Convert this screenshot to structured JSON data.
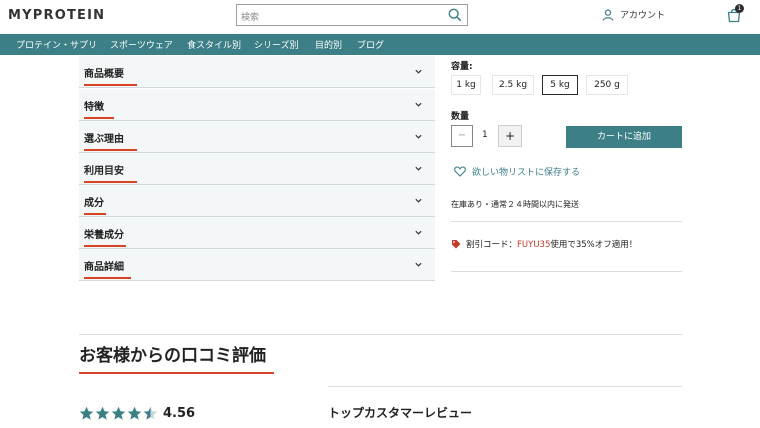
{
  "header": {
    "logo": "MYPROTEIN",
    "search_placeholder": "検索",
    "account_label": "アカウント",
    "bag_count": "1"
  },
  "nav": {
    "items": [
      {
        "label": "プロテイン・サプリ"
      },
      {
        "label": "スポーツウェア"
      },
      {
        "label": "食スタイル別"
      },
      {
        "label": "シリーズ別"
      },
      {
        "label": "目的別"
      },
      {
        "label": "ブログ"
      }
    ]
  },
  "accordion": {
    "items": [
      {
        "label": "商品概要"
      },
      {
        "label": "特徴"
      },
      {
        "label": "選ぶ理由"
      },
      {
        "label": "利用目安"
      },
      {
        "label": "成分"
      },
      {
        "label": "栄養成分"
      },
      {
        "label": "商品詳細"
      }
    ]
  },
  "product": {
    "capacity_label": "容量:",
    "sizes": [
      {
        "label": "1 kg",
        "selected": false
      },
      {
        "label": "2.5 kg",
        "selected": false
      },
      {
        "label": "5 kg",
        "selected": true
      },
      {
        "label": "250 g",
        "selected": false
      }
    ],
    "quantity_label": "数量",
    "quantity_minus": "−",
    "quantity_value": "1",
    "quantity_plus": "+",
    "add_to_cart": "カートに追加",
    "wishlist": "欲しい物リストに保存する",
    "stock": "在庫あり・通常２４時間以内に発送",
    "promo_prefix": "割引コード：",
    "promo_code": "FUYU35",
    "promo_suffix": "使用で35%オフ適用！"
  },
  "reviews": {
    "title": "お客様からの口コミ評価",
    "rating": "4.56",
    "stars_value": 4.56,
    "top_reviews_title": "トップカスタマーレビュー"
  },
  "colors": {
    "accent": "#3c7f86",
    "underline": "#d64326",
    "promo": "#c43a2b"
  }
}
